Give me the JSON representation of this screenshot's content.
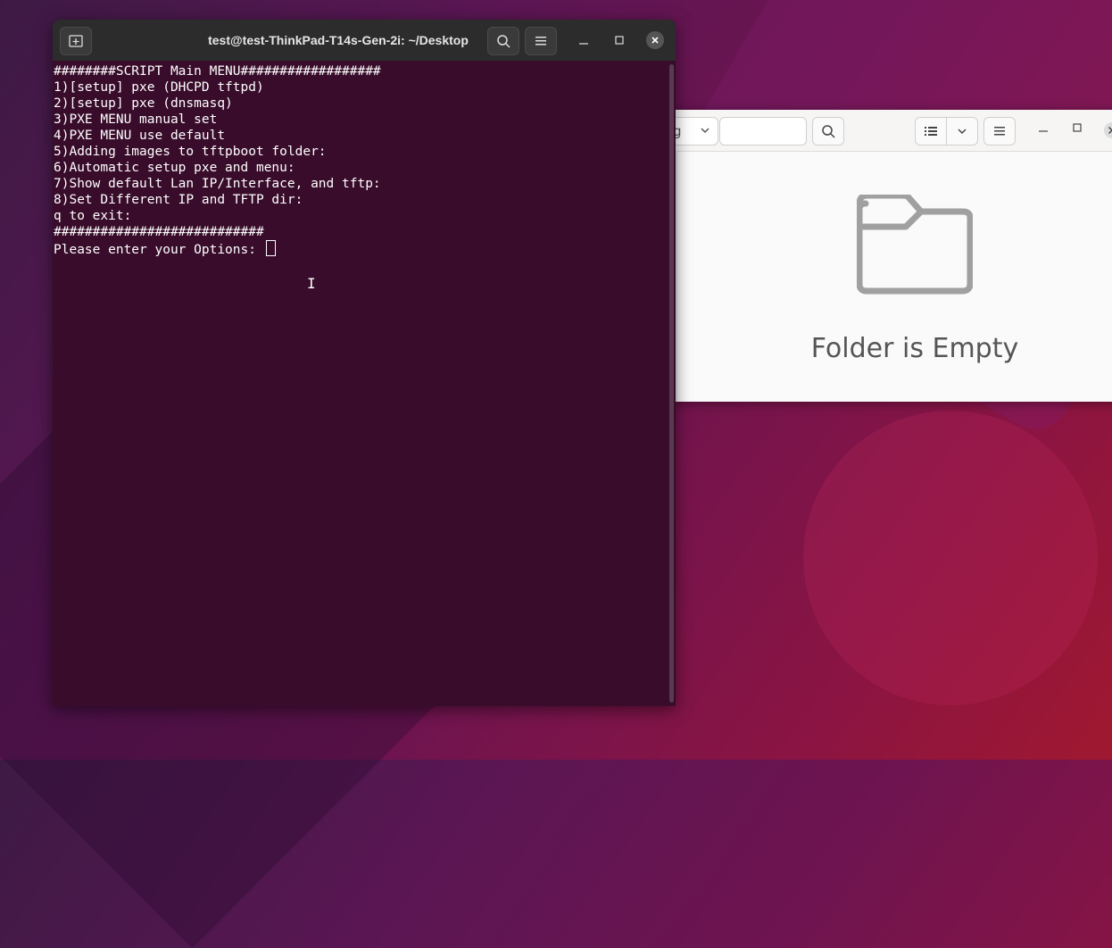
{
  "files_window": {
    "path_partial": "g",
    "empty_message": "Folder is Empty"
  },
  "terminal": {
    "title": "test@test-ThinkPad-T14s-Gen-2i: ~/Desktop",
    "lines": [
      "########SCRIPT Main MENU##################",
      "1)[setup] pxe (DHCPD tftpd)",
      "2)[setup] pxe (dnsmasq)",
      "3)PXE MENU manual set",
      "4)PXE MENU use default",
      "5)Adding images to tftpboot folder:",
      "6)Automatic setup pxe and menu:",
      "7)Show default Lan IP/Interface, and tftp:",
      "8)Set Different IP and TFTP dir:",
      "q to exit:",
      "###########################"
    ],
    "prompt": "Please enter your Options: "
  },
  "icons": {
    "terminal_newtab": "new-tab-icon",
    "terminal_search": "search-icon",
    "terminal_menu": "hamburger-menu-icon",
    "files_search": "search-icon",
    "files_list_view": "list-view-icon",
    "files_empty": "folder-icon"
  },
  "colors": {
    "terminal_bg": "#380c2a",
    "header_bg": "#2c2c2c",
    "files_bg": "#fafafa"
  }
}
